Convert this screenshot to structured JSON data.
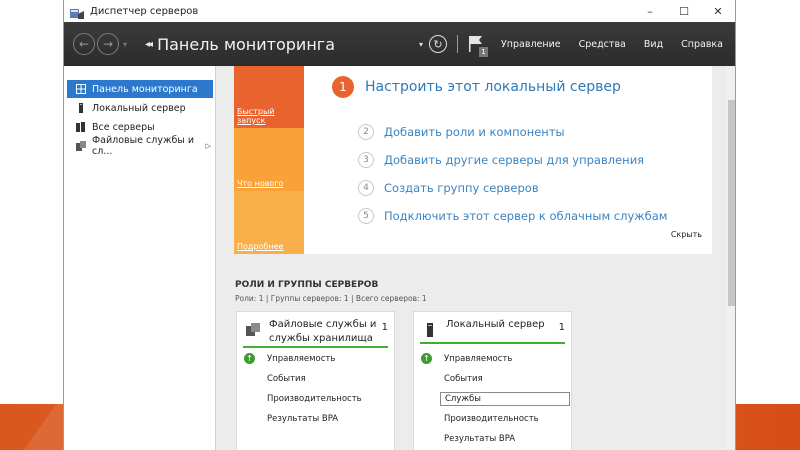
{
  "window": {
    "title": "Диспетчер серверов",
    "controls": {
      "minimize": "–",
      "maximize": "☐",
      "close": "✕"
    }
  },
  "toolbar": {
    "back_icon": "←",
    "forward_icon": "→",
    "dropdown_icon": "▾",
    "breadcrumb_arrows": "◂◂",
    "page_title": "Панель мониторинга",
    "refresh_icon": "↻",
    "notification_count": "1",
    "menu": [
      "Управление",
      "Средства",
      "Вид",
      "Справка"
    ]
  },
  "sidebar": {
    "items": [
      {
        "label": "Панель мониторинга",
        "icon": "dashboard-icon",
        "active": true
      },
      {
        "label": "Локальный сервер",
        "icon": "local-server-icon",
        "active": false
      },
      {
        "label": "Все серверы",
        "icon": "all-servers-icon",
        "active": false
      },
      {
        "label": "Файловые службы и сл...",
        "icon": "file-services-icon",
        "active": false,
        "expand": "▷"
      }
    ]
  },
  "quick_start": {
    "tabs": [
      "Быстрый запуск",
      "Что нового",
      "Подробнее"
    ],
    "primary_step": {
      "number": "1",
      "label": "Настроить этот локальный сервер"
    },
    "steps": [
      {
        "number": "2",
        "label": "Добавить роли и компоненты"
      },
      {
        "number": "3",
        "label": "Добавить другие серверы для управления"
      },
      {
        "number": "4",
        "label": "Создать группу серверов"
      },
      {
        "number": "5",
        "label": "Подключить этот сервер к облачным службам"
      }
    ],
    "hide_label": "Скрыть"
  },
  "roles": {
    "title": "РОЛИ И ГРУППЫ СЕРВЕРОВ",
    "subtitle": "Роли: 1 | Группы серверов: 1 | Всего серверов: 1",
    "tiles": [
      {
        "title": "Файловые службы и службы хранилища",
        "count": "1",
        "rows": [
          "Управляемость",
          "События",
          "Производительность",
          "Результаты BPA"
        ]
      },
      {
        "title": "Локальный сервер",
        "count": "1",
        "rows": [
          "Управляемость",
          "События",
          "Службы",
          "Производительность",
          "Результаты BPA"
        ]
      }
    ]
  },
  "colors": {
    "accent_orange": "#e8632e",
    "tab_light_orange": "#f9a237",
    "link_blue": "#2e79b9",
    "selection_blue": "#2b78cc",
    "status_green": "#3fae32"
  }
}
